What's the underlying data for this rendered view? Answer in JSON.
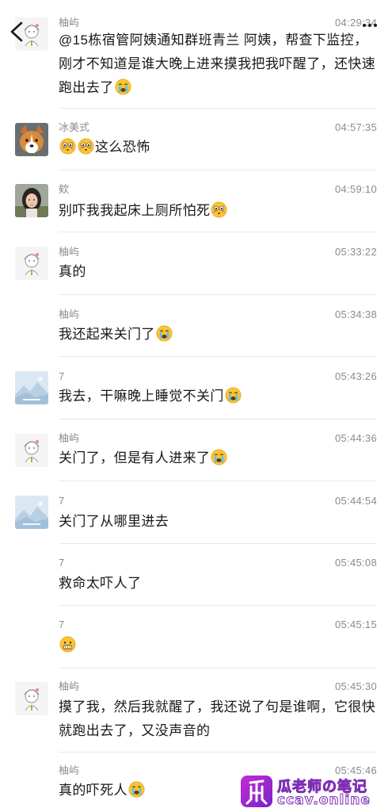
{
  "nav": {
    "back_icon": "back-chevron-icon",
    "more_icon": "more-dots-icon"
  },
  "messages": [
    {
      "sender": "柚屿",
      "time": "04:29:34",
      "avatar": "sketch-girl",
      "text": "@15栋宿管阿姨通知群班青兰 阿姨，帮查下监控，刚才不知道是谁大晚上进来摸我把我吓醒了，还快速跑出去了",
      "emoji_after": [
        "crying"
      ]
    },
    {
      "sender": "冰美式",
      "time": "04:57:35",
      "avatar": "corgi",
      "emoji_before": [
        "flushed",
        "flushed"
      ],
      "text": "这么恐怖"
    },
    {
      "sender": "欸",
      "time": "04:59:10",
      "avatar": "girl-photo",
      "text": "别吓我我起床上厕所怕死",
      "emoji_after": [
        "flushed"
      ]
    },
    {
      "sender": "柚屿",
      "time": "05:33:22",
      "avatar": "sketch-girl",
      "text": "真的"
    },
    {
      "sender": "柚屿",
      "time": "05:34:38",
      "avatar": "",
      "text": "我还起来关门了",
      "emoji_after": [
        "crying"
      ]
    },
    {
      "sender": "7",
      "time": "05:43:26",
      "avatar": "landscape",
      "text": "我去，干嘛晚上睡觉不关门",
      "emoji_after": [
        "crying"
      ]
    },
    {
      "sender": "柚屿",
      "time": "05:44:36",
      "avatar": "sketch-girl",
      "text": "关门了，但是有人进来了",
      "emoji_after": [
        "crying"
      ]
    },
    {
      "sender": "7",
      "time": "05:44:54",
      "avatar": "landscape",
      "text": "关门了从哪里进去"
    },
    {
      "sender": "7",
      "time": "05:45:08",
      "avatar": "",
      "text": "救命太吓人了"
    },
    {
      "sender": "7",
      "time": "05:45:15",
      "avatar": "",
      "text": "",
      "emoji_after": [
        "grimace"
      ]
    },
    {
      "sender": "柚屿",
      "time": "05:45:30",
      "avatar": "sketch-girl",
      "text": "摸了我，然后我就醒了，我还说了句是谁啊，它很快就跑出去了，又没声音的"
    },
    {
      "sender": "柚屿",
      "time": "05:45:46",
      "avatar": "",
      "text": "真的吓死人",
      "emoji_after": [
        "crying"
      ]
    }
  ],
  "watermark": {
    "line1": "瓜老师の笔记",
    "line2": "ccav.online"
  },
  "colors": {
    "text": "#181818",
    "meta": "#8b8b8b",
    "divider": "#e9e9e9"
  }
}
